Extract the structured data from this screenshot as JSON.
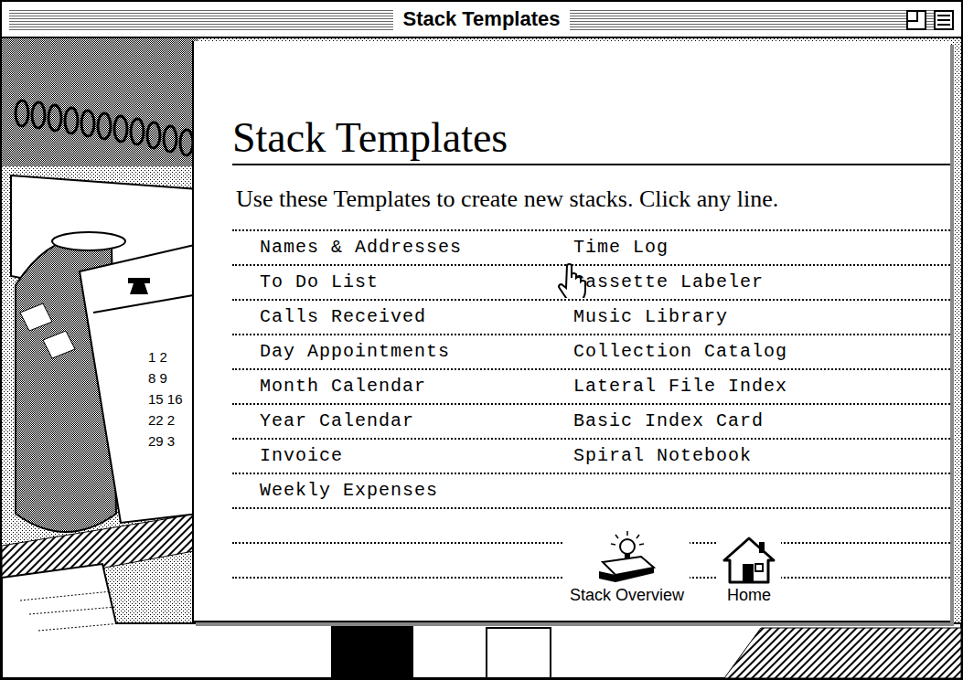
{
  "window": {
    "title": "Stack Templates"
  },
  "heading": "Stack Templates",
  "instructions": "Use these Templates to create new stacks. Click any line.",
  "templates": {
    "left": [
      "Names & Addresses",
      "To Do List",
      "Calls Received",
      "Day Appointments",
      "Month Calendar",
      "Year Calendar",
      "Invoice",
      "Weekly Expenses"
    ],
    "right": [
      "Time Log",
      "Cassette Labeler",
      "Music Library",
      "Collection Catalog",
      "Lateral File Index",
      "Basic Index Card",
      "Spiral Notebook"
    ]
  },
  "illustration": {
    "calendar_rows": [
      "1 2",
      "8 9",
      "15 16",
      "22 2",
      "29 3"
    ]
  },
  "buttons": [
    {
      "label": "Stack Overview"
    },
    {
      "label": "Home"
    }
  ]
}
